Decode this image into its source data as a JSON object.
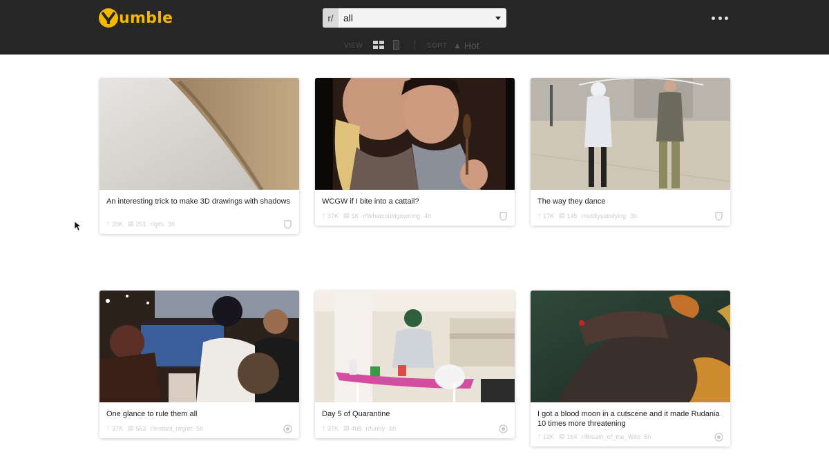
{
  "app": {
    "name": "umble",
    "logo_letter": "Y"
  },
  "selector": {
    "prefix": "r/",
    "value": "all"
  },
  "controls": {
    "view_label": "VIEW",
    "sort_label": "SORT",
    "sort_value": "Hot"
  },
  "colors": {
    "accent": "#f5b800",
    "topbar": "#262626"
  },
  "posts": [
    {
      "title": "An interesting trick to make 3D drawings with shadows",
      "upvotes": "20K",
      "comments": "251",
      "subreddit": "r/gifs",
      "age": "3h",
      "badge": "shield-icon"
    },
    {
      "title": "WCGW if I bite into a cattail?",
      "upvotes": "37K",
      "comments": "1K",
      "subreddit": "r/Whatcouldgowrong",
      "age": "4h",
      "badge": "shield-icon"
    },
    {
      "title": "The way they dance",
      "upvotes": "17K",
      "comments": "145",
      "subreddit": "r/oddlysatisfying",
      "age": "3h",
      "badge": "shield-icon"
    },
    {
      "title": "One glance to rule them all",
      "upvotes": "37K",
      "comments": "663",
      "subreddit": "r/instant_regret",
      "age": "5h",
      "badge": "award-icon"
    },
    {
      "title": "Day 5 of Quarantine",
      "upvotes": "37K",
      "comments": "468",
      "subreddit": "r/funny",
      "age": "6h",
      "badge": "award-icon"
    },
    {
      "title": "I got a blood moon in a cutscene and it made Rudania 10 times more threatening",
      "upvotes": "12K",
      "comments": "164",
      "subreddit": "r/Breath_of_the_Wild",
      "age": "5h",
      "badge": "award-icon"
    }
  ]
}
